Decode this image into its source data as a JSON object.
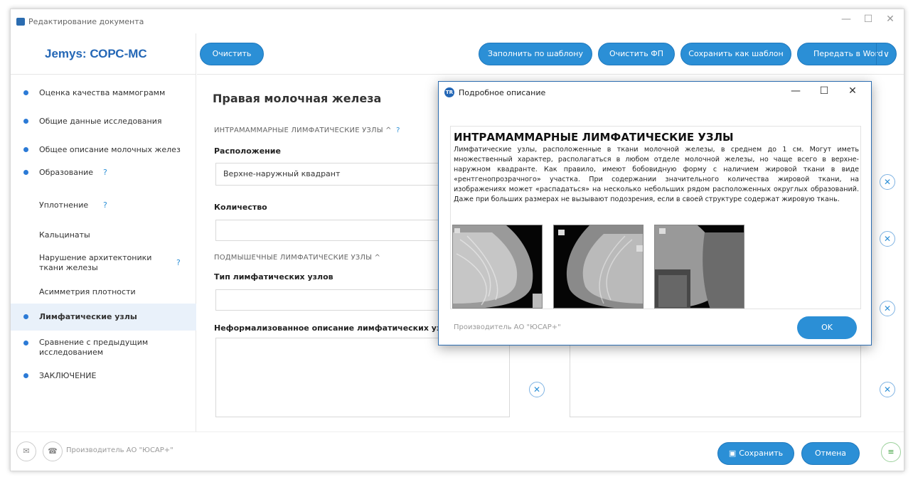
{
  "window": {
    "title": "Редактирование документа",
    "minimize": "—",
    "maximize": "☐",
    "close": "✕"
  },
  "sidebar": {
    "brand": "Jemys: СОРС-МС",
    "items": [
      {
        "label": "Оценка качества маммограмм"
      },
      {
        "label": "Общие данные исследования"
      },
      {
        "label": "Общее описание молочных желез"
      },
      {
        "label": "Образование",
        "help": "?"
      },
      {
        "label": "Уплотнение",
        "help": "?"
      },
      {
        "label": "Кальцинаты"
      },
      {
        "label": "Нарушение архитектоники ткани железы",
        "help": "?"
      },
      {
        "label": "Асимметрия плотности"
      },
      {
        "label": "Лимфатические узлы"
      },
      {
        "label": "Сравнение с предыдущим исследованием"
      },
      {
        "label": "ЗАКЛЮЧЕНИЕ"
      }
    ]
  },
  "toolbar": {
    "clear": "Очистить",
    "fill_template": "Заполнить по шаблону",
    "clear_fp": "Очистить ФП",
    "save_template": "Сохранить как шаблон",
    "send_word": "Передать в Word"
  },
  "main": {
    "title": "Правая молочная железа",
    "section1": "ИНТРАМАММАРНЫЕ ЛИМФАТИЧЕСКИЕ УЗЛЫ ^",
    "help": "?",
    "location_label": "Расположение",
    "location_value": "Верхне-наружный квадрант",
    "count_label": "Количество",
    "count_value": "",
    "section2": "ПОДМЫШЕЧНЫЕ ЛИМФАТИЧЕСКИЕ УЗЛЫ ^",
    "type_label": "Тип лимфатических узлов",
    "type_value": "",
    "informal_label": "Неформализованное описание лимфатических узлов:",
    "informal_value": ""
  },
  "footer": {
    "maker": "Производитель АО \"ЮСАР+\"",
    "save": "Сохранить",
    "cancel": "Отмена"
  },
  "dialog": {
    "icon_text": "TR",
    "title": "Подробное описание",
    "heading": "ИНТРАМАММАРНЫЕ ЛИМФАТИЧЕСКИЕ УЗЛЫ",
    "text": "Лимфатические узлы, расположенные в ткани молочной железы, в среднем до 1 см. Могут иметь множественный характер, располагаться в любом отделе молочной железы, но чаще всего в верхне-наружном квадранте. Как правило, имеют бобовидную форму с наличием жировой ткани в виде «рентгенопрозрачного» участка. При содержании значительного количества жировой ткани, на изображениях может «распадаться» на несколько небольших рядом расположенных округлых образований. Даже при больших размерах не вызывают подозрения, если в своей структуре содержат жировую ткань.",
    "maker": "Производитель АО \"ЮСАР+\"",
    "ok": "OK"
  }
}
